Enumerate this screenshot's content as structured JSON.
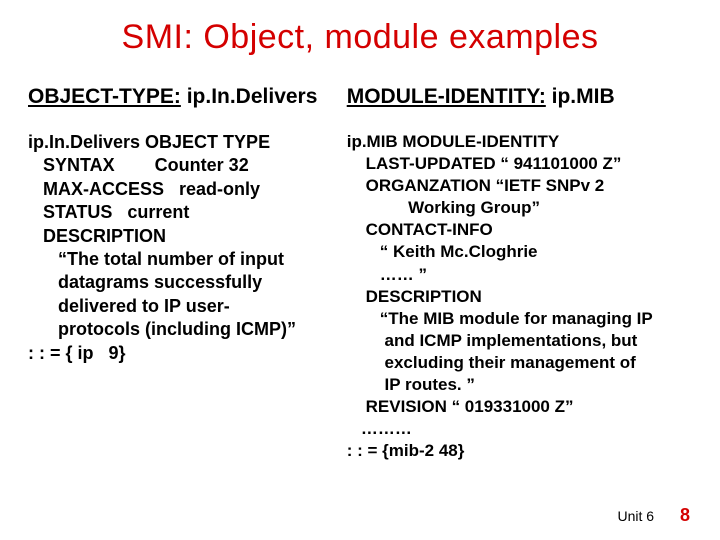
{
  "title": "SMI: Object, module examples",
  "left": {
    "label": "OBJECT-TYPE:",
    "name": " ip.In.Delivers",
    "lines": [
      "ip.In.Delivers OBJECT TYPE",
      "   SYNTAX        Counter 32",
      "   MAX-ACCESS   read-only",
      "   STATUS   current",
      "   DESCRIPTION",
      "      “The total number of input",
      "      datagrams successfully",
      "      delivered to IP user-",
      "      protocols (including ICMP)”",
      ": : = { ip   9}"
    ]
  },
  "right": {
    "label": "MODULE-IDENTITY:",
    "name": " ip.MIB",
    "lines": [
      "ip.MIB MODULE-IDENTITY",
      "    LAST-UPDATED “ 941101000 Z”",
      "    ORGANZATION “IETF SNPv 2",
      "             Working Group”",
      "    CONTACT-INFO",
      "       “ Keith Mc.Cloghrie",
      "       …… ”",
      "    DESCRIPTION",
      "       “The MIB module for managing IP",
      "        and ICMP implementations, but",
      "        excluding their management of",
      "        IP routes. ”",
      "    REVISION “ 019331000 Z”",
      "   ………",
      ": : = {mib-2 48}"
    ]
  },
  "footer": {
    "unit": "Unit 6",
    "page": "8"
  }
}
